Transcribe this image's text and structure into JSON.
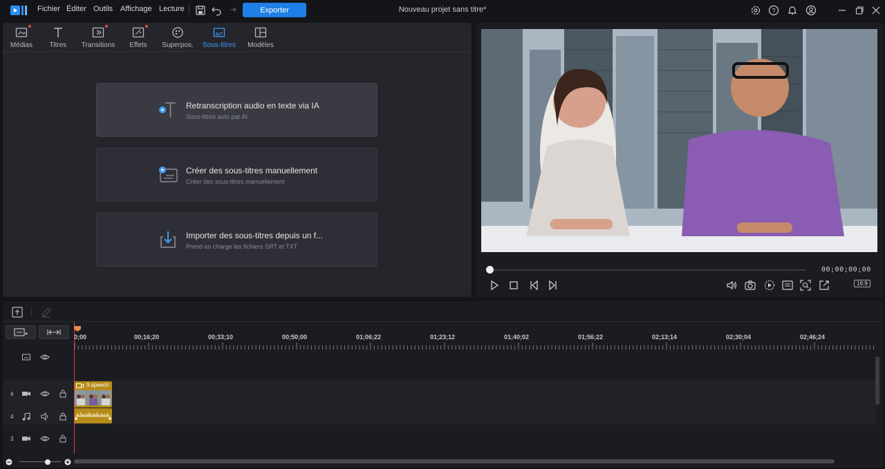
{
  "menu": [
    "Fichier",
    "Éditer",
    "Outils",
    "Affichage",
    "Lecture"
  ],
  "export_label": "Exporter",
  "project_title": "Nouveau projet sans titre*",
  "tabs": [
    {
      "label": "Médias",
      "icon": "media-icon",
      "badge": true
    },
    {
      "label": "Titres",
      "icon": "title-icon",
      "badge": false
    },
    {
      "label": "Transitions",
      "icon": "transition-icon",
      "badge": true
    },
    {
      "label": "Effets",
      "icon": "effects-icon",
      "badge": true
    },
    {
      "label": "Superpos.",
      "icon": "overlay-icon",
      "badge": false
    },
    {
      "label": "Sous-titres",
      "icon": "subtitles-icon",
      "badge": false,
      "active": true
    },
    {
      "label": "Modèles",
      "icon": "templates-icon",
      "badge": false
    }
  ],
  "cards": [
    {
      "title": "Retranscription audio en texte via IA",
      "subtitle": "Sous-titres auto par AI"
    },
    {
      "title": "Créer des sous-titres manuellement",
      "subtitle": "Créer des sous-titres manuellement"
    },
    {
      "title": "Importer des sous-titres depuis un f...",
      "subtitle": "Prend en charge les fichiers SRT et TXT"
    }
  ],
  "preview": {
    "timecode": "00;00;00;00",
    "aspect_ratio": "16:9",
    "progress": 0
  },
  "timeline": {
    "ticks": [
      "0;00",
      "00;16;20",
      "00;33;10",
      "00;50;00",
      "01;06;22",
      "01;23;12",
      "01;40;02",
      "01;56;22",
      "02;13;14",
      "02;30;04",
      "02;46;24"
    ],
    "tracks": [
      {
        "num": "",
        "type": "subtitle"
      },
      {
        "num": "4",
        "type": "video"
      },
      {
        "num": "4",
        "type": "audio"
      },
      {
        "num": "3",
        "type": "video"
      }
    ],
    "clip_name": "9.speech"
  },
  "colors": {
    "accent": "#1e7fe6",
    "active_tab": "#3f9bf4",
    "clip": "#b58c18",
    "playhead": "#e0412e"
  }
}
